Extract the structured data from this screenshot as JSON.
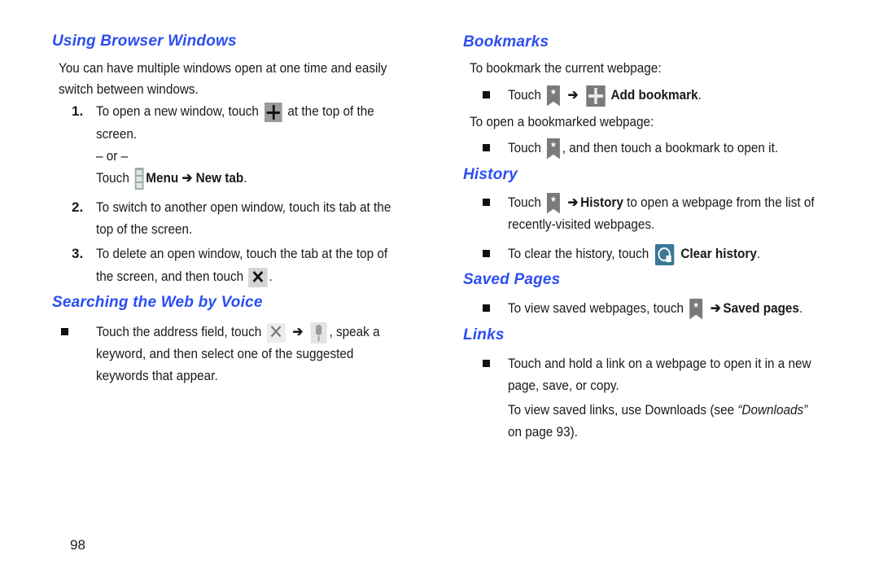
{
  "page_number": "98",
  "left": {
    "sections": [
      {
        "title": "Using Browser Windows",
        "intro": [
          "You can have multiple windows open at one time and easily",
          "switch between windows."
        ],
        "steps": [
          {
            "number": "1.",
            "line1_before": "To open a new window, touch",
            "line1_icon": "plus-icon",
            "line1_after": "at the top of the",
            "line2": "screen.",
            "or": "– or –",
            "alt_touch": "Touch",
            "alt_icon": "menu-icon",
            "alt_bold": "Menu ➔ New tab",
            "alt_end": "."
          },
          {
            "number": "2.",
            "line1": "To switch to another open window, touch its tab at the",
            "line2": "top of the screen."
          },
          {
            "number": "3.",
            "line1": "To delete an open window, touch the tab at the top of",
            "line2_before": "the screen, and then touch",
            "line2_icon": "close-icon",
            "line2_after": "."
          }
        ]
      },
      {
        "title": "Searching the Web by Voice",
        "bullet": {
          "line1_before": "Touch the address field, touch",
          "icon1": "close-icon",
          "arrow": "➔",
          "icon2": "microphone-icon",
          "line1_after": ", speak a",
          "line2": "keyword, and then select one of the suggested",
          "line3": "keywords that appear."
        }
      }
    ]
  },
  "right": {
    "bookmarks": {
      "title": "Bookmarks",
      "p1": "To bookmark the current webpage:",
      "b1_touch": "Touch",
      "b1_arrow": "➔",
      "b1_bold": "Add bookmark",
      "b1_end": ".",
      "p2": "To open a bookmarked webpage:",
      "b2_touch": "Touch",
      "b2_after": ", and then touch a bookmark to open it."
    },
    "history": {
      "title": "History",
      "b1_touch": "Touch",
      "b1_arrow": "➔",
      "b1_bold": "History",
      "b1_after": "to open a webpage from the list of",
      "b1_line2": "recently-visited webpages.",
      "b2_before": "To clear the history, touch",
      "b2_bold": "Clear history",
      "b2_end": "."
    },
    "saved_pages": {
      "title": "Saved Pages",
      "b1_before": "To view saved webpages, touch",
      "b1_arrow": "➔",
      "b1_bold": "Saved pages",
      "b1_end": "."
    },
    "links": {
      "title": "Links",
      "b1_line1": "Touch and hold a link on a webpage to open it in a new",
      "b1_line2": "page, save, or copy.",
      "p_before": "To view saved links, use Downloads (see ",
      "p_italic": "“Downloads”",
      "p_line2": "on page 93)."
    }
  },
  "colors": {
    "heading": "#2b4ef2",
    "text": "#1a1a1a"
  }
}
